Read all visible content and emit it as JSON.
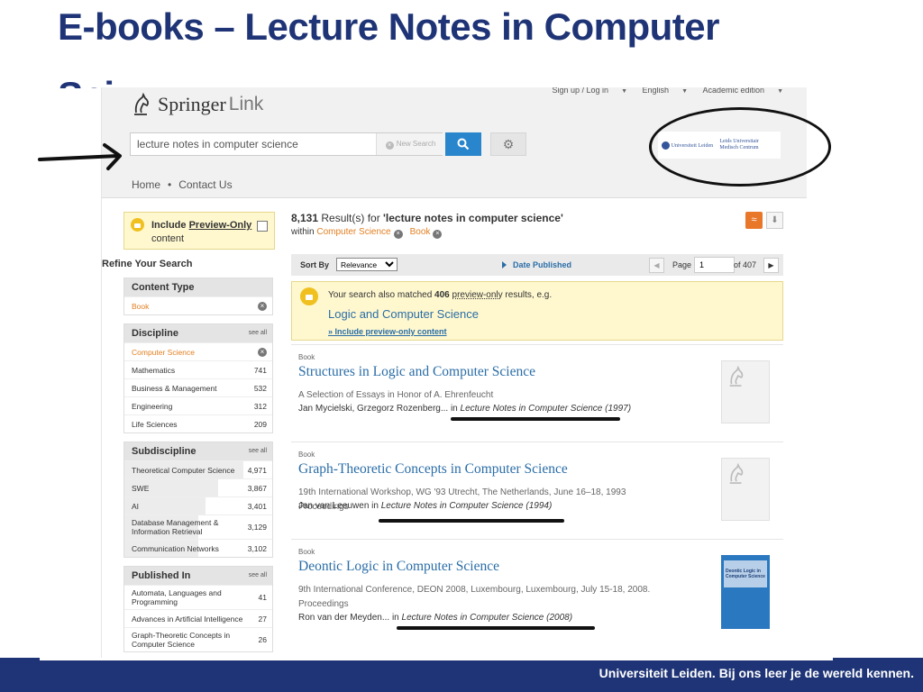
{
  "slide": {
    "title": "E-books – Lecture Notes in Computer",
    "title_cut": "Sci",
    "footer": "Universiteit Leiden. Bij ons leer je de wereld kennen."
  },
  "colors": {
    "navy": "#1f3476",
    "link": "#2a6da7",
    "accent": "#e37f22",
    "highlight": "#fff8cf"
  },
  "header": {
    "utility": {
      "signup": "Sign up / Log in",
      "language": "English",
      "edition": "Academic edition"
    },
    "logo": {
      "word1": "Springer",
      "word2": "Link",
      "icon": "springer-horse-icon"
    },
    "search": {
      "value": "lecture notes in computer science",
      "new_search": "New Search",
      "icon": "search-icon",
      "settings_icon": "gear-icon"
    },
    "partners": {
      "left": "Universiteit Leiden",
      "right": "Leids Universitair Medisch Centrum"
    },
    "nav": {
      "home": "Home",
      "sep": "•",
      "contact": "Contact Us"
    }
  },
  "sidebar": {
    "preview_label": "Include",
    "preview_link": "Preview-Only",
    "preview_suffix": "content",
    "refine": "Refine Your Search",
    "facets": {
      "content_type": {
        "title": "Content Type",
        "selected": "Book"
      },
      "discipline": {
        "title": "Discipline",
        "see_all": "see all",
        "selected": "Computer Science",
        "items": [
          {
            "label": "Mathematics",
            "count": "741"
          },
          {
            "label": "Business & Management",
            "count": "532"
          },
          {
            "label": "Engineering",
            "count": "312"
          },
          {
            "label": "Life Sciences",
            "count": "209"
          }
        ]
      },
      "subdiscipline": {
        "title": "Subdiscipline",
        "see_all": "see all",
        "items": [
          {
            "label": "Theoretical Computer Science",
            "count": "4,971",
            "share": 1.0
          },
          {
            "label": "SWE",
            "count": "3,867",
            "share": 0.79
          },
          {
            "label": "AI",
            "count": "3,401",
            "share": 0.68
          },
          {
            "label": "Database Management & Information Retrieval",
            "count": "3,129",
            "share": 0.62
          },
          {
            "label": "Communication Networks",
            "count": "3,102",
            "share": 0.62
          }
        ]
      },
      "published_in": {
        "title": "Published In",
        "see_all": "see all",
        "items": [
          {
            "label": "Automata, Languages and Programming",
            "count": "41"
          },
          {
            "label": "Advances in Artificial Intelligence",
            "count": "27"
          },
          {
            "label": "Graph-Theoretic Concepts in Computer Science",
            "count": "26"
          }
        ]
      }
    }
  },
  "results": {
    "count": "8,131",
    "count_text": " Result(s) for ",
    "query": "'lecture notes in computer science'",
    "within": "within",
    "filter1": "Computer Science",
    "filter2": "Book",
    "sort_by": "Sort By",
    "sort_value": "Relevance",
    "date_published": "Date Published",
    "page_label": "Page",
    "page_value": "1",
    "page_of": "of 407",
    "matched": {
      "text1": "Your search also matched ",
      "count": "406",
      "link": "preview-only",
      "text2": " results, e.g.",
      "example": "Logic and Computer Science",
      "include": "» Include preview-only content"
    },
    "items": [
      {
        "type": "Book",
        "title": "Structures in Logic and Computer Science",
        "subtitle": "A Selection of Essays in Honor of A. Ehrenfeucht",
        "authors": "Jan Mycielski, Grzegorz Rozenberg...",
        "in": " in ",
        "series": "Lecture Notes in Computer Science (1997)"
      },
      {
        "type": "Book",
        "title": "Graph-Theoretic Concepts in Computer Science",
        "subtitle": "19th International Workshop, WG '93 Utrecht, The Netherlands, June 16–18, 1993 Proceedings",
        "authors": "Jan van Leeuwen",
        "in": " in ",
        "series": "Lecture Notes in Computer Science (1994)"
      },
      {
        "type": "Book",
        "title": "Deontic Logic in Computer Science",
        "subtitle": "9th International Conference, DEON 2008, Luxembourg, Luxembourg, July 15-18, 2008. Proceedings",
        "authors": "Ron van der Meyden...",
        "in": " in ",
        "series": "Lecture Notes in Computer Science (2008)",
        "cover_text": "Deontic Logic in Computer Science"
      }
    ]
  }
}
